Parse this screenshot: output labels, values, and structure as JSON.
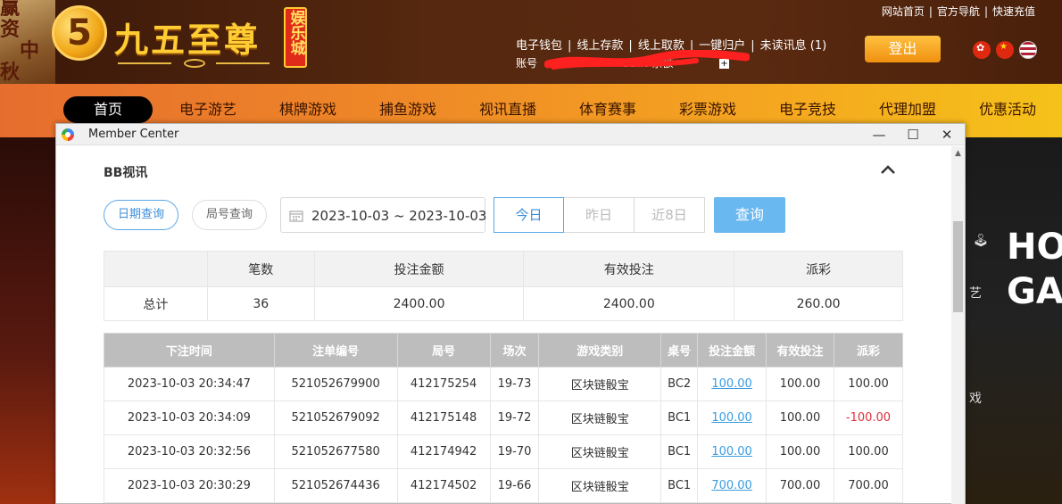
{
  "brand": {
    "logo_mark": "5",
    "name": "九五至尊",
    "badge": "娱乐城",
    "side_text": [
      "赢",
      "资",
      "中",
      "秋"
    ]
  },
  "top_links": [
    "网站首页",
    "官方导航",
    "快速充值"
  ],
  "account": {
    "links": [
      "电子钱包",
      "线上存款",
      "线上取款",
      "一键归户",
      "未读讯息 (1)"
    ],
    "row2_prefix": "账号",
    "row2_mid": "BBIN 余额"
  },
  "logout_label": "登出",
  "languages": [
    "hk-flag-icon",
    "cn-flag-icon",
    "us-flag-icon"
  ],
  "nav": [
    "首页",
    "电子游艺",
    "棋牌游戏",
    "捕鱼游戏",
    "视讯直播",
    "体育赛事",
    "彩票游戏",
    "电子竞技",
    "代理加盟",
    "优惠活动"
  ],
  "side_right": {
    "hot_line1": "HOT",
    "hot_line2": "GAM",
    "glyph1": "艺",
    "glyph2": "戏"
  },
  "window": {
    "title": "Member Center",
    "controls": [
      "—",
      "☐",
      "✕"
    ]
  },
  "section": {
    "title": "BB视讯",
    "query_mode_date": "日期查询",
    "query_mode_round": "局号查询",
    "date_range": "2023-10-03 ~ 2023-10-03",
    "quick": [
      "今日",
      "昨日",
      "近8日"
    ],
    "query_button": "查询"
  },
  "summary": {
    "headers": [
      "",
      "笔数",
      "投注金额",
      "有效投注",
      "派彩"
    ],
    "row": [
      "总计",
      "36",
      "2400.00",
      "2400.00",
      "260.00"
    ]
  },
  "detail": {
    "headers": [
      "下注时间",
      "注单编号",
      "局号",
      "场次",
      "游戏类别",
      "桌号",
      "投注金额",
      "有效投注",
      "派彩"
    ],
    "rows": [
      [
        "2023-10-03 20:34:47",
        "521052679900",
        "412175254",
        "19-73",
        "区块链骰宝",
        "BC2",
        "100.00",
        "100.00",
        "100.00"
      ],
      [
        "2023-10-03 20:34:09",
        "521052679092",
        "412175148",
        "19-72",
        "区块链骰宝",
        "BC1",
        "100.00",
        "100.00",
        "-100.00"
      ],
      [
        "2023-10-03 20:32:56",
        "521052677580",
        "412174942",
        "19-70",
        "区块链骰宝",
        "BC1",
        "100.00",
        "100.00",
        "100.00"
      ],
      [
        "2023-10-03 20:30:29",
        "521052674436",
        "412174502",
        "19-66",
        "区块链骰宝",
        "BC1",
        "700.00",
        "700.00",
        "700.00"
      ]
    ]
  },
  "colors": {
    "accent_blue": "#3b8ed8",
    "query_button": "#6ab8f0",
    "negative": "#e0303a",
    "nav_start": "#e66d2e",
    "nav_end": "#f5c21a"
  }
}
